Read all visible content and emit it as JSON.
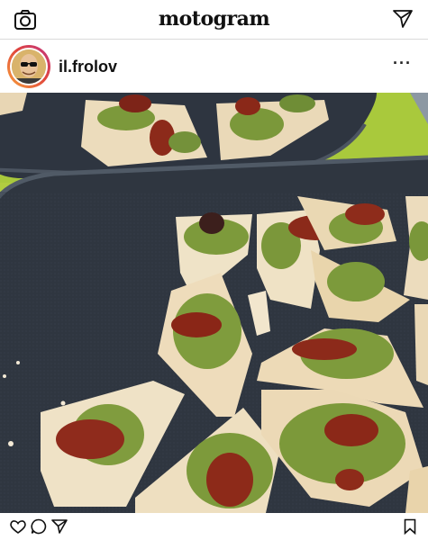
{
  "app": {
    "logo_text": "motogram"
  },
  "header": {
    "camera_icon": "camera-icon",
    "direct_icon": "paper-plane-icon"
  },
  "post": {
    "username": "il.frolov",
    "more_label": "···",
    "image_alt": "Bruschetta with pesto and sun-dried tomatoes on dark trays",
    "actions": {
      "like_icon": "heart-icon",
      "comment_icon": "comment-icon",
      "share_icon": "paper-plane-icon",
      "save_icon": "bookmark-icon"
    }
  },
  "colors": {
    "tray": "#2f3640",
    "table": "#a7c93a",
    "bread": "#efe2c6",
    "pesto": "#7f9a3c",
    "tomato": "#8e2a1c"
  }
}
